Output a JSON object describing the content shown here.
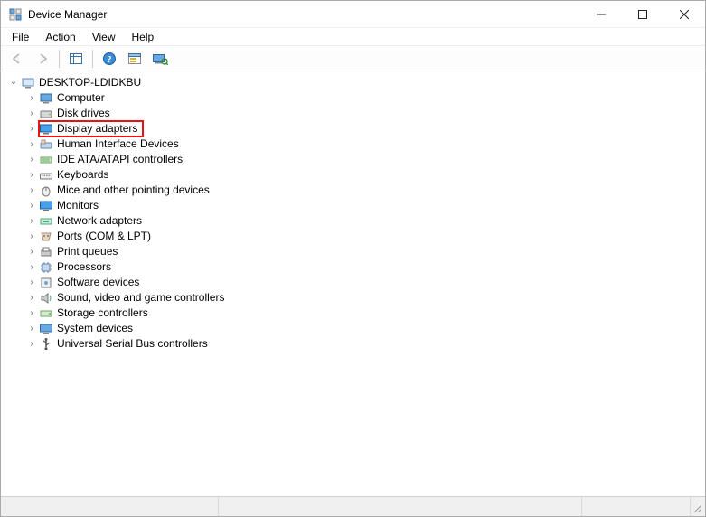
{
  "window": {
    "title": "Device Manager"
  },
  "menus": {
    "file": "File",
    "action": "Action",
    "view": "View",
    "help": "Help"
  },
  "tree": {
    "root": "DESKTOP-LDIDKBU",
    "items": [
      "Computer",
      "Disk drives",
      "Display adapters",
      "Human Interface Devices",
      "IDE ATA/ATAPI controllers",
      "Keyboards",
      "Mice and other pointing devices",
      "Monitors",
      "Network adapters",
      "Ports (COM & LPT)",
      "Print queues",
      "Processors",
      "Software devices",
      "Sound, video and game controllers",
      "Storage controllers",
      "System devices",
      "Universal Serial Bus controllers"
    ],
    "highlight_index": 2
  },
  "icons": {
    "app": "device-manager",
    "back": "back",
    "forward": "forward",
    "show_hidden": "show-hidden",
    "help": "help",
    "props": "properties",
    "scan": "scan-hardware"
  }
}
